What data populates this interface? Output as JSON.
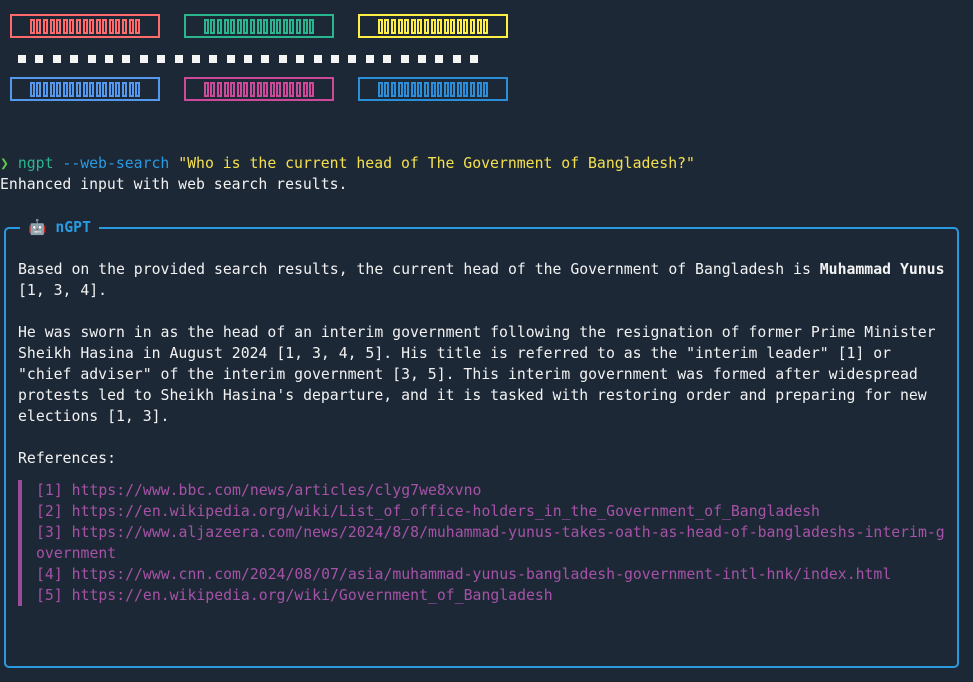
{
  "logo": {
    "colors": [
      "#ff6b6b",
      "#2bb58f",
      "#ffee44",
      "#5599ee",
      "#cc4a99",
      "#2a8fd8"
    ],
    "glyph_count": 17,
    "dot_count": 27
  },
  "prompt": {
    "symbol": "❯",
    "command": "ngpt",
    "flag": "--web-search",
    "query": "\"Who is the current head of The Government of Bangladesh?\""
  },
  "status": "Enhanced input with web search results.",
  "panel": {
    "icon": "🤖",
    "title": "nGPT",
    "p1_before": "Based on the provided search results, the current head of the Government of Bangladesh is ",
    "p1_bold": "Muhammad Yunus",
    "p1_after": " [1, 3, 4].",
    "p2": "He was sworn in as the head of an interim government following the resignation of former Prime Minister Sheikh Hasina in August 2024 [1, 3, 4, 5]. His title is referred to as the \"interim leader\" [1] or \"chief adviser\" of the interim government [3, 5]. This interim government was formed after widespread protests led to Sheikh Hasina's departure, and it is tasked with restoring order and preparing for new elections [1, 3].",
    "refs_heading": "References:",
    "refs": [
      {
        "n": "[1]",
        "url": "https://www.bbc.com/news/articles/clyg7we8xvno"
      },
      {
        "n": "[2]",
        "url": "https://en.wikipedia.org/wiki/List_of_office-holders_in_the_Government_of_Bangladesh"
      },
      {
        "n": "[3]",
        "url": "https://www.aljazeera.com/news/2024/8/8/muhammad-yunus-takes-oath-as-head-of-bangladeshs-interim-government"
      },
      {
        "n": "[4]",
        "url": "https://www.cnn.com/2024/08/07/asia/muhammad-yunus-bangladesh-government-intl-hnk/index.html"
      },
      {
        "n": "[5]",
        "url": "https://en.wikipedia.org/wiki/Government_of_Bangladesh"
      }
    ]
  }
}
